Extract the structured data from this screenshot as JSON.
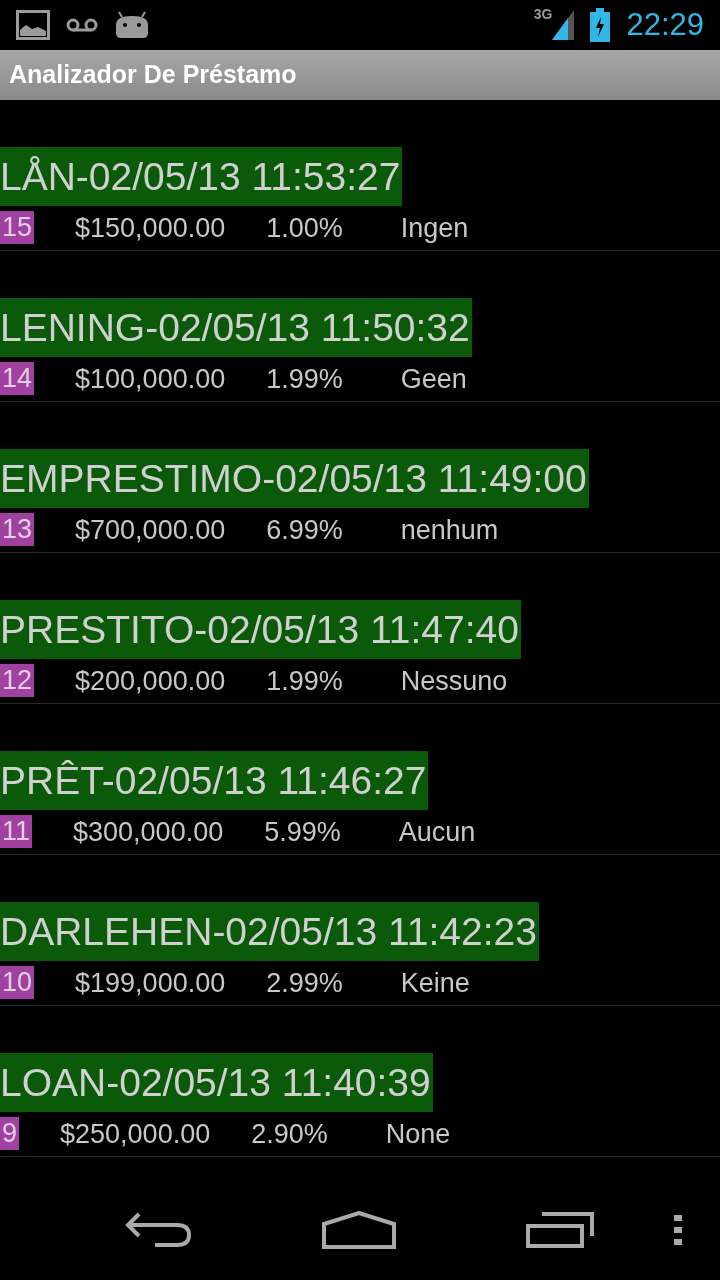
{
  "status_bar": {
    "network": "3G",
    "time": "22:29"
  },
  "app_bar": {
    "title": "Analizador De Préstamo"
  },
  "loans": [
    {
      "title": "LÅN-02/05/13 11:53:27",
      "number": "15",
      "amount": "$150,000.00",
      "rate": "1.00%",
      "column_4": "Ingen"
    },
    {
      "title": "LENING-02/05/13 11:50:32",
      "number": "14",
      "amount": "$100,000.00",
      "rate": "1.99%",
      "column_4": "Geen"
    },
    {
      "title": "EMPRESTIMO-02/05/13 11:49:00",
      "number": "13",
      "amount": "$700,000.00",
      "rate": "6.99%",
      "column_4": "nenhum"
    },
    {
      "title": "PRESTITO-02/05/13 11:47:40",
      "number": "12",
      "amount": "$200,000.00",
      "rate": "1.99%",
      "column_4": "Nessuno"
    },
    {
      "title": "PRÊT-02/05/13 11:46:27",
      "number": "11",
      "amount": "$300,000.00",
      "rate": "5.99%",
      "column_4": "Aucun"
    },
    {
      "title": "DARLEHEN-02/05/13 11:42:23",
      "number": "10",
      "amount": "$199,000.00",
      "rate": "2.99%",
      "column_4": "Keine"
    },
    {
      "title": "LOAN-02/05/13 11:40:39",
      "number": "9",
      "amount": "$250,000.00",
      "rate": "2.90%",
      "column_4": "None"
    }
  ]
}
